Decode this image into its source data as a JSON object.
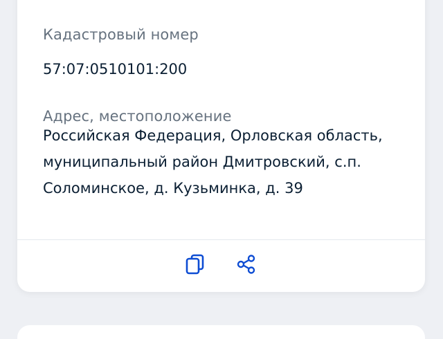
{
  "details": {
    "cadastral": {
      "label": "Кадастровый номер",
      "value": "57:07:0510101:200"
    },
    "address": {
      "label": "Адрес, местоположение",
      "lines": [
        "Российская Федерация, Орловская область,",
        "муниципальный район Дмитровский, с.п.",
        "Соломинское, д. Кузьминка, д. 39"
      ]
    }
  },
  "actions": {
    "copy_icon": "copy-icon",
    "share_icon": "share-icon"
  },
  "colors": {
    "accent": "#0d4cd3",
    "label": "#66727f",
    "text": "#0b1f33",
    "background": "#eef0f4",
    "card": "#ffffff"
  }
}
